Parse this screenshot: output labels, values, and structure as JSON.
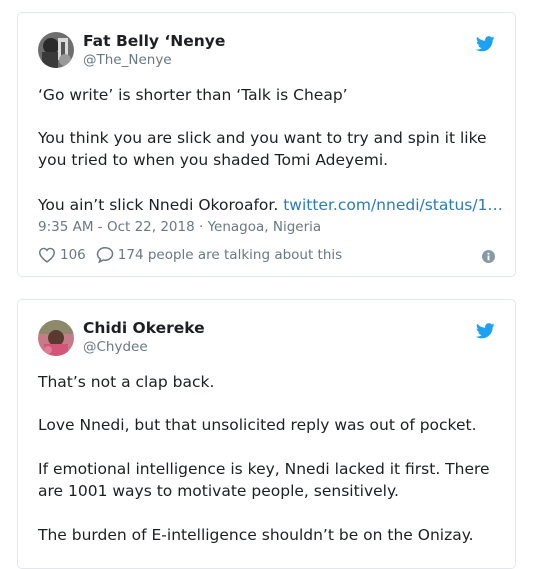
{
  "tweets": [
    {
      "name": "Fat Belly ‘Nenye",
      "handle": "@The_Nenye",
      "paragraphs": [
        "‘Go write’ is shorter than ‘Talk is Cheap’",
        "You think you are slick and you want to try and spin it like you tried to when you shaded Tomi Adeyemi.",
        "You ain’t slick Nnedi Okoroafor."
      ],
      "link_text": "twitter.com/nnedi/status/1…",
      "meta": "9:35 AM - Oct 22, 2018 · Yenagoa, Nigeria",
      "likes": "106",
      "talking": "174 people are talking about this"
    },
    {
      "name": "Chidi Okereke",
      "handle": "@Chydee",
      "paragraphs": [
        "That’s not a clap back.",
        "Love Nnedi, but that unsolicited reply was out of pocket.",
        "If emotional intelligence is key, Nnedi lacked it first. There are 1001 ways to motivate people, sensitively.",
        "The burden of E-intelligence shouldn’t be on the Onizay."
      ]
    }
  ],
  "colors": {
    "twitter_blue": "#1da1f2",
    "link": "#2b7bb9",
    "muted": "#697882",
    "text": "#1c2022",
    "border": "#e1e8ed"
  },
  "icons": {
    "brand": "twitter-bird-icon",
    "like": "heart-icon",
    "reply": "speech-bubble-icon",
    "info": "info-icon"
  }
}
